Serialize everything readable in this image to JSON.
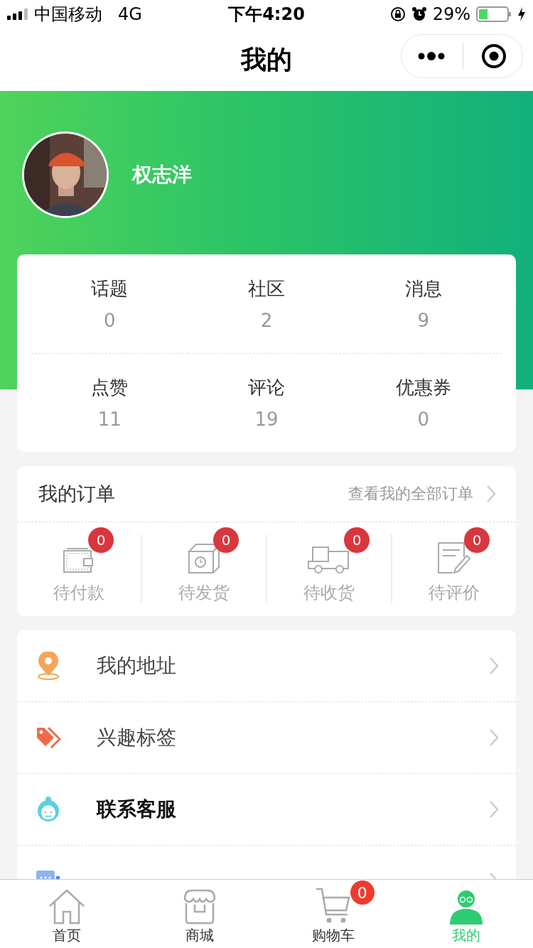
{
  "status_bar": {
    "carrier": "中国移动",
    "network": "4G",
    "time": "下午4:20",
    "battery": "29%"
  },
  "nav": {
    "title": "我的"
  },
  "profile": {
    "name": "权志洋"
  },
  "stats": [
    {
      "label": "话题",
      "value": "0"
    },
    {
      "label": "社区",
      "value": "2"
    },
    {
      "label": "消息",
      "value": "9"
    },
    {
      "label": "点赞",
      "value": "11"
    },
    {
      "label": "评论",
      "value": "19"
    },
    {
      "label": "优惠券",
      "value": "0"
    }
  ],
  "orders": {
    "title": "我的订单",
    "link": "查看我的全部订单",
    "items": [
      {
        "label": "待付款",
        "count": "0",
        "kind": "wallet"
      },
      {
        "label": "待发货",
        "count": "0",
        "kind": "box"
      },
      {
        "label": "待收货",
        "count": "0",
        "kind": "truck"
      },
      {
        "label": "待评价",
        "count": "0",
        "kind": "note"
      }
    ]
  },
  "menu": [
    {
      "label": "我的地址",
      "kind": "location",
      "bold": false
    },
    {
      "label": "兴趣标签",
      "kind": "tag",
      "bold": false
    },
    {
      "label": "联系客服",
      "kind": "service",
      "bold": true
    },
    {
      "kind": "feedback"
    }
  ],
  "tabbar": [
    {
      "label": "首页",
      "kind": "home",
      "selected": false
    },
    {
      "label": "商城",
      "kind": "shop",
      "selected": false
    },
    {
      "label": "购物车",
      "kind": "cart",
      "selected": false,
      "badge": "0"
    },
    {
      "label": "我的",
      "kind": "me",
      "selected": true
    }
  ]
}
